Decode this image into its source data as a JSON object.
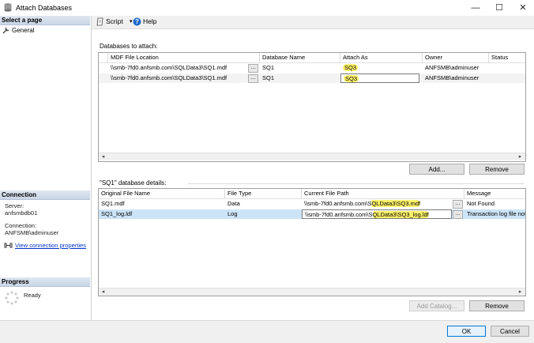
{
  "window": {
    "title": "Attach Databases",
    "minimize": "—",
    "maximize": "☐",
    "close": "✕"
  },
  "left": {
    "select_page_header": "Select a page",
    "pages": [
      {
        "label": "General"
      }
    ],
    "connection_header": "Connection",
    "server_label": "Server:",
    "server_value": "anfsmbdb01",
    "connection_label": "Connection:",
    "connection_value": "ANFSMB\\adminuser",
    "view_props": "View connection properties",
    "progress_header": "Progress",
    "progress_status": "Ready"
  },
  "toolbar": {
    "script": "Script",
    "help": "Help"
  },
  "attach": {
    "label": "Databases to attach:",
    "columns": [
      "MDF File Location",
      "Database Name",
      "Attach As",
      "Owner",
      "Status"
    ],
    "rows": [
      {
        "mdf": "\\\\smb-7fd0.anfsmb.com\\SQLData3\\SQ1.mdf",
        "dbname": "SQ1",
        "attach_as": "SQ3",
        "owner": "ANFSMB\\adminuser",
        "status": ""
      },
      {
        "mdf": "\\\\smb-7fd0.anfsmb.com\\SQLData3\\SQ1.mdf",
        "dbname": "SQ1",
        "attach_as": "SQ3",
        "owner": "ANFSMB\\adminuser",
        "status": ""
      }
    ],
    "add": "Add...",
    "remove": "Remove"
  },
  "details": {
    "label": "\"SQ1\" database details:",
    "columns": [
      "Original File Name",
      "File Type",
      "Current File Path",
      "Message"
    ],
    "rows": [
      {
        "orig": "SQ1.mdf",
        "type": "Data",
        "path": "\\\\smb-7fd0.anfsmb.com\\SQLData3\\SQ3.mdf",
        "message": "Not Found"
      },
      {
        "orig": "SQ1_log.ldf",
        "type": "Log",
        "path": "\\\\smb-7fd0.anfsmb.com\\SQLData3\\SQ3_log.ldf",
        "message": "Transaction log file not"
      }
    ],
    "add_catalog": "Add Catalog...",
    "remove": "Remove"
  },
  "footer": {
    "ok": "OK",
    "cancel": "Cancel"
  },
  "ellipsis": "...",
  "colors": {
    "highlight": "#fdf26a",
    "selected_row": "#cce4f7",
    "section_header": "#c9d6e6",
    "link": "#0033cc"
  }
}
